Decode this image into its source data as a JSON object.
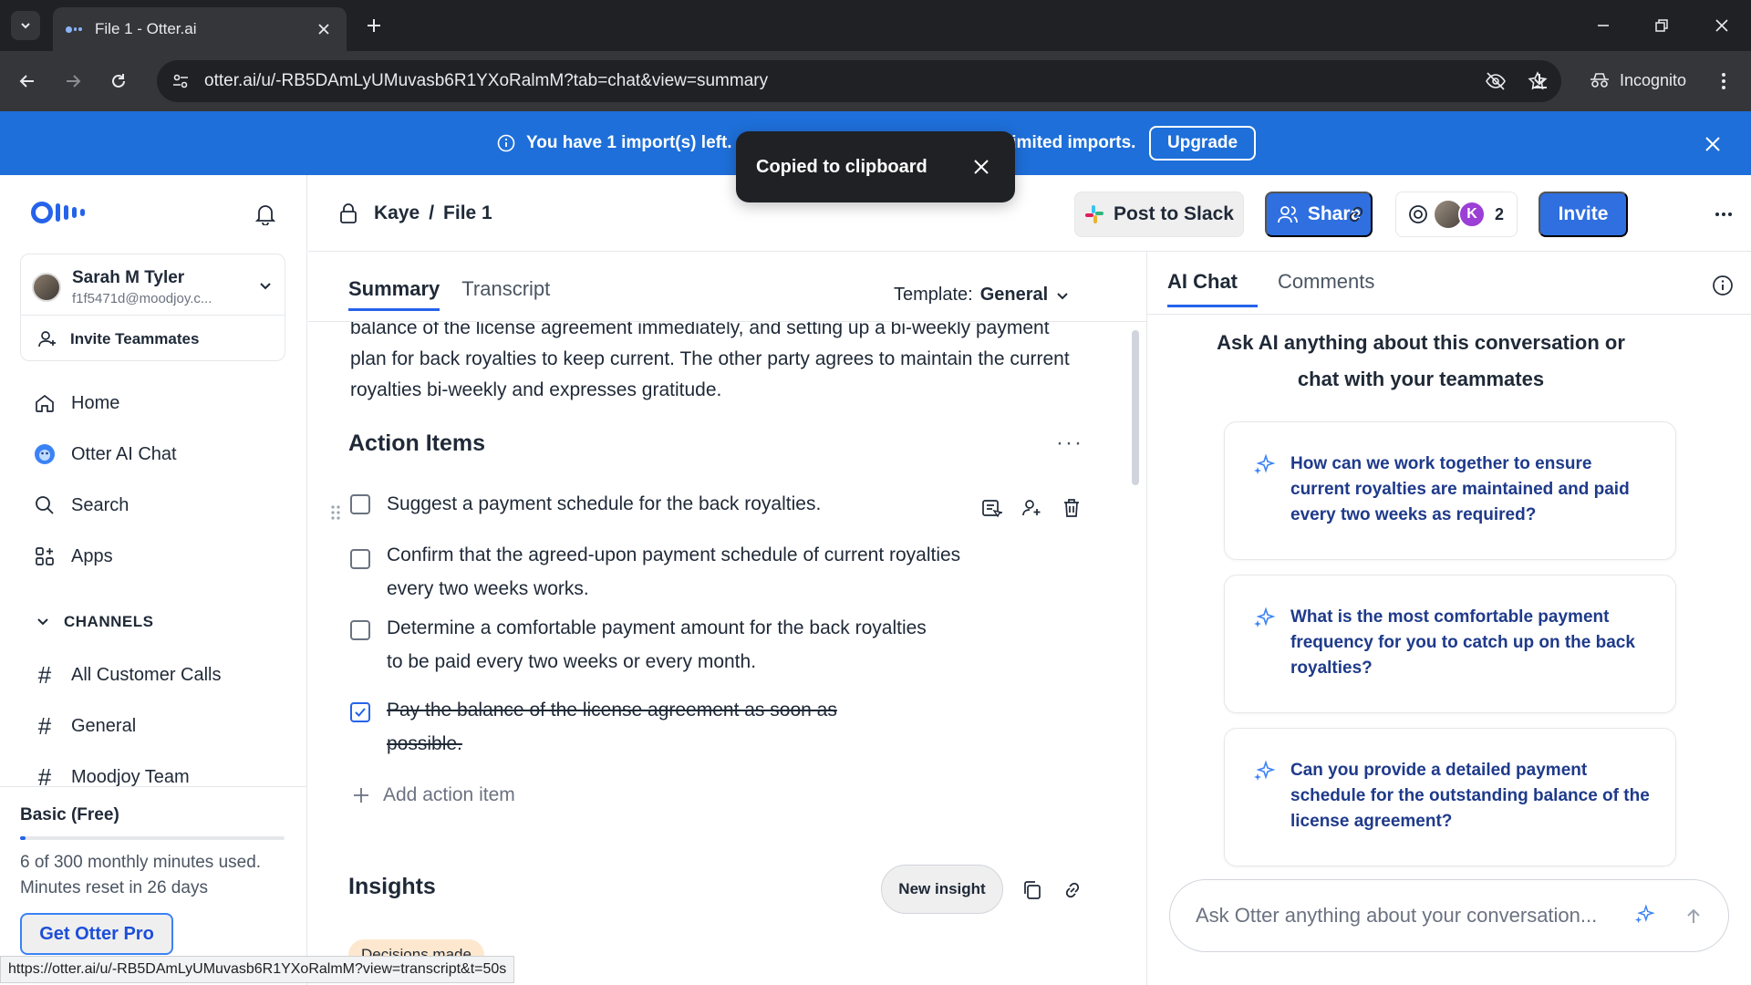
{
  "browser": {
    "tab_title": "File 1 - Otter.ai",
    "url": "otter.ai/u/-RB5DAmLyUMuvasb6R1YXoRalmM?tab=chat&view=summary",
    "incognito_label": "Incognito",
    "status_url": "https://otter.ai/u/-RB5DAmLyUMuvasb6R1YXoRalmM?view=transcript&t=50s"
  },
  "banner": {
    "message_start": "You have 1 import(s) left.",
    "message_end": "limited imports.",
    "upgrade_label": "Upgrade",
    "color": "#1e6fd9"
  },
  "toast": {
    "text": "Copied to clipboard"
  },
  "sidebar": {
    "user_name": "Sarah M Tyler",
    "user_email": "f1f5471d@moodjoy.c...",
    "invite_label": "Invite Teammates",
    "nav": [
      {
        "label": "Home",
        "icon": "home-icon"
      },
      {
        "label": "Otter AI Chat",
        "icon": "otter-chat-icon"
      },
      {
        "label": "Search",
        "icon": "search-icon"
      },
      {
        "label": "Apps",
        "icon": "apps-icon"
      }
    ],
    "channels_header": "CHANNELS",
    "channels": [
      "All Customer Calls",
      "General",
      "Moodjoy Team"
    ],
    "plan": {
      "name": "Basic (Free)",
      "usage_fraction": 0.02,
      "usage_text": "6 of 300 monthly minutes used.",
      "reset_text": "Minutes reset in 26 days",
      "cta": "Get Otter Pro"
    }
  },
  "header": {
    "breadcrumb_owner": "Kaye",
    "breadcrumb_sep": "/",
    "breadcrumb_file": "File 1",
    "post_slack": "Post to Slack",
    "share": "Share",
    "collab_initial": "K",
    "collab_count": "2",
    "invite": "Invite"
  },
  "main": {
    "tabs": [
      "Summary",
      "Transcript"
    ],
    "template_label": "Template:",
    "template_value": "General",
    "summary_text": "balance of the license agreement immediately, and setting up a bi-weekly payment plan for back royalties to keep current. The other party agrees to maintain the current royalties bi-weekly and expresses gratitude.",
    "action_items_title": "Action Items",
    "action_items": [
      {
        "text": "Suggest a payment schedule for the back royalties.",
        "checked": false
      },
      {
        "text": "Confirm that the agreed-upon payment schedule of current royalties every two weeks works.",
        "checked": false
      },
      {
        "text": "Determine a comfortable payment amount for the back royalties to be paid every two weeks or every month.",
        "checked": false
      },
      {
        "text": "Pay the balance of the license agreement as soon as possible.",
        "checked": true
      }
    ],
    "add_action_item": "Add action item",
    "insights_title": "Insights",
    "new_insight": "New insight",
    "decisions_chip": "Decisions made"
  },
  "right_panel": {
    "tabs": [
      "AI Chat",
      "Comments"
    ],
    "heading": "Ask AI anything about this conversation or chat with your teammates",
    "suggestions": [
      "How can we work together to ensure current royalties are maintained and paid every two weeks as required?",
      "What is the most comfortable payment frequency for you to catch up on the back royalties?",
      "Can you provide a detailed payment schedule for the outstanding balance of the license agreement?"
    ],
    "input_placeholder": "Ask Otter anything about your conversation..."
  },
  "colors": {
    "primary": "#2f6fe0",
    "link": "#1e3a8a"
  }
}
